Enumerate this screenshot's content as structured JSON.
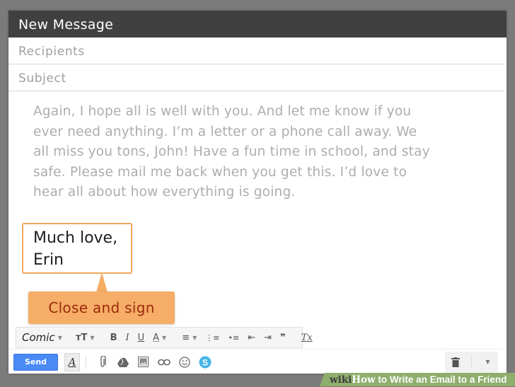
{
  "compose": {
    "title": "New Message",
    "recipients_placeholder": "Recipients",
    "subject_placeholder": "Subject",
    "body_text": "Again, I hope all is well with you. And let me know if you\never need anything. I’m a letter or a phone call away. We\nall miss you tons, John! Have a fun time in school, and stay\nsafe.  Please mail me back when you get this. I’d love to\nhear all about how everything is going.",
    "signature_line1": "Much love,",
    "signature_line2": "Erin"
  },
  "annotation": {
    "callout": "Close and sign",
    "accent_color": "#f6ad67",
    "text_color": "#9b2a0c"
  },
  "format_toolbar": {
    "font": "Comic",
    "items": [
      {
        "name": "text-size-icon",
        "glyph": "ᴛT"
      },
      {
        "name": "bold-icon",
        "glyph": "B"
      },
      {
        "name": "italic-icon",
        "glyph": "I"
      },
      {
        "name": "underline-icon",
        "glyph": "U"
      },
      {
        "name": "text-color-icon",
        "glyph": "A"
      },
      {
        "name": "align-icon",
        "glyph": "≡"
      },
      {
        "name": "numbered-list-icon",
        "glyph": "⋮≡"
      },
      {
        "name": "bulleted-list-icon",
        "glyph": "•≡"
      },
      {
        "name": "indent-less-icon",
        "glyph": "⇤"
      },
      {
        "name": "indent-more-icon",
        "glyph": "⇥"
      },
      {
        "name": "quote-icon",
        "glyph": "❞"
      },
      {
        "name": "remove-formatting-icon",
        "glyph": "Tx"
      }
    ]
  },
  "bottom_toolbar": {
    "send_label": "Send",
    "format_toggle_glyph": "A",
    "send_color": "#4a8af4"
  },
  "banner": {
    "wiki": "wiki",
    "how": "How",
    "title": " to Write an Email to a Friend",
    "color": "#8fae6e"
  }
}
